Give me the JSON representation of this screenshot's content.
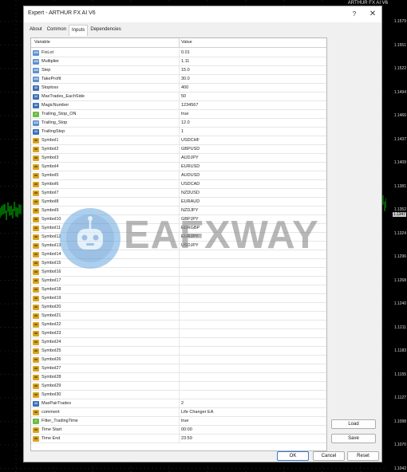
{
  "chart": {
    "title": "ARTHUR FX AI V6",
    "prices": [
      "1.1579",
      "1.1551",
      "1.1522",
      "1.1494",
      "1.1466",
      "1.1437",
      "1.1409",
      "1.1381",
      "1.1352",
      "1.1324",
      "1.1296",
      "1.1268",
      "1.1240",
      "1.1211",
      "1.1183",
      "1.1155",
      "1.1127",
      "1.1098",
      "1.1070",
      "1.1042"
    ],
    "current_price": "1.1347"
  },
  "dialog": {
    "title": "Expert - ARTHUR FX AI V6",
    "help_label": "?",
    "close_label": "✕",
    "tabs": [
      {
        "label": "About"
      },
      {
        "label": "Common"
      },
      {
        "label": "Inputs"
      },
      {
        "label": "Dependencies"
      }
    ],
    "columns": {
      "variable": "Variable",
      "value": "Value"
    },
    "rows": [
      {
        "name": "FixLot",
        "value": "0.01",
        "icon": "i123"
      },
      {
        "name": "Multiplier",
        "value": "1.11",
        "icon": "i123"
      },
      {
        "name": "Step",
        "value": "15.0",
        "icon": "i123"
      },
      {
        "name": "TakeProfit",
        "value": "30.0",
        "icon": "i123"
      },
      {
        "name": "Stoploss",
        "value": "400",
        "icon": "i12"
      },
      {
        "name": "MaxTrades_EachSide",
        "value": "50",
        "icon": "i12"
      },
      {
        "name": "MagicNumber",
        "value": "1234567",
        "icon": "i12"
      },
      {
        "name": "Trailing_Stop_ON",
        "value": "true",
        "icon": "ibool"
      },
      {
        "name": "Trailing_Stop",
        "value": "12.0",
        "icon": "i123"
      },
      {
        "name": "TrailingStep",
        "value": "1",
        "icon": "i12"
      },
      {
        "name": "Symbol1",
        "value": "USDCHF",
        "icon": "iab"
      },
      {
        "name": "Symbol2",
        "value": "GBPUSD",
        "icon": "iab"
      },
      {
        "name": "Symbol3",
        "value": "AUDJPY",
        "icon": "iab"
      },
      {
        "name": "Symbol4",
        "value": "EURUSD",
        "icon": "iab"
      },
      {
        "name": "Symbol5",
        "value": "AUDUSD",
        "icon": "iab"
      },
      {
        "name": "Symbol6",
        "value": "USDCAD",
        "icon": "iab"
      },
      {
        "name": "Symbol7",
        "value": "NZDUSD",
        "icon": "iab"
      },
      {
        "name": "Symbol8",
        "value": "EURAUD",
        "icon": "iab"
      },
      {
        "name": "Symbol9",
        "value": "NZDJPY",
        "icon": "iab"
      },
      {
        "name": "Symbol10",
        "value": "GBPJPY",
        "icon": "iab"
      },
      {
        "name": "Symbol11",
        "value": "EURGBP",
        "icon": "iab"
      },
      {
        "name": "Symbol12",
        "value": "EURJPY",
        "icon": "iab"
      },
      {
        "name": "Symbol13",
        "value": "USDJPY",
        "icon": "iab"
      },
      {
        "name": "Symbol14",
        "value": "",
        "icon": "iab"
      },
      {
        "name": "Symbol15",
        "value": "",
        "icon": "iab"
      },
      {
        "name": "Symbol16",
        "value": "",
        "icon": "iab"
      },
      {
        "name": "Symbol17",
        "value": "",
        "icon": "iab"
      },
      {
        "name": "Symbol18",
        "value": "",
        "icon": "iab"
      },
      {
        "name": "Symbol19",
        "value": "",
        "icon": "iab"
      },
      {
        "name": "Symbol20",
        "value": "",
        "icon": "iab"
      },
      {
        "name": "Symbol21",
        "value": "",
        "icon": "iab"
      },
      {
        "name": "Symbol22",
        "value": "",
        "icon": "iab"
      },
      {
        "name": "Symbol23",
        "value": "",
        "icon": "iab"
      },
      {
        "name": "Symbol24",
        "value": "",
        "icon": "iab"
      },
      {
        "name": "Symbol25",
        "value": "",
        "icon": "iab"
      },
      {
        "name": "Symbol26",
        "value": "",
        "icon": "iab"
      },
      {
        "name": "Symbol27",
        "value": "",
        "icon": "iab"
      },
      {
        "name": "Symbol28",
        "value": "",
        "icon": "iab"
      },
      {
        "name": "Symbol29",
        "value": "",
        "icon": "iab"
      },
      {
        "name": "Symbol30",
        "value": "",
        "icon": "iab"
      },
      {
        "name": "MaxPairTrades",
        "value": "2",
        "icon": "i12"
      },
      {
        "name": "comment",
        "value": "Life Changer EA",
        "icon": "iab"
      },
      {
        "name": "Filter_TradingTime",
        "value": "true",
        "icon": "ibool"
      },
      {
        "name": "Time Start",
        "value": "00:00",
        "icon": "iab"
      },
      {
        "name": "Time End",
        "value": "23:59",
        "icon": "iab"
      }
    ],
    "buttons": {
      "load": "Load",
      "save": "Save",
      "ok": "OK",
      "cancel": "Cancel",
      "reset": "Reset"
    }
  },
  "icon_labels": {
    "i123": "123",
    "i12": "12",
    "iab": "ab",
    "ibool": "✓"
  },
  "watermark": {
    "text": "EAFXWAY"
  },
  "colors": {
    "chart_bg": "#000000",
    "candle": "#00c800",
    "accent": "#3a78d4"
  }
}
